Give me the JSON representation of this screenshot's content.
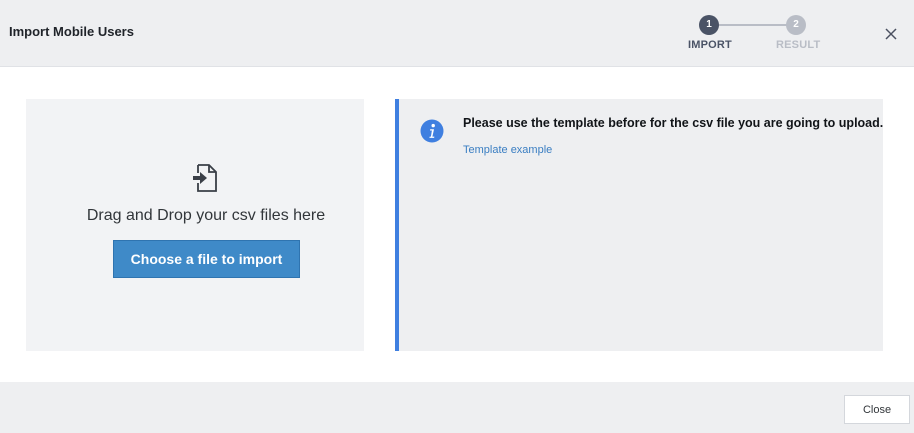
{
  "dialog": {
    "title": "Import Mobile Users",
    "close_icon": "close-icon"
  },
  "stepper": {
    "steps": [
      {
        "number": "1",
        "label": "IMPORT",
        "state": "active"
      },
      {
        "number": "2",
        "label": "RESULT",
        "state": "inactive"
      }
    ],
    "active_color": "#4a5366",
    "inactive_color": "#b9bdc6"
  },
  "dropzone": {
    "icon": "file-import-icon",
    "text": "Drag and Drop your csv files here",
    "button_label": "Choose a file to import",
    "button_color": "#3f8ac8"
  },
  "info": {
    "icon": "info-icon",
    "message": "Please use the template before for the csv file you are going to upload.",
    "link_label": "Template example",
    "accent_color": "#3f7fe0"
  },
  "footer": {
    "close_label": "Close"
  }
}
